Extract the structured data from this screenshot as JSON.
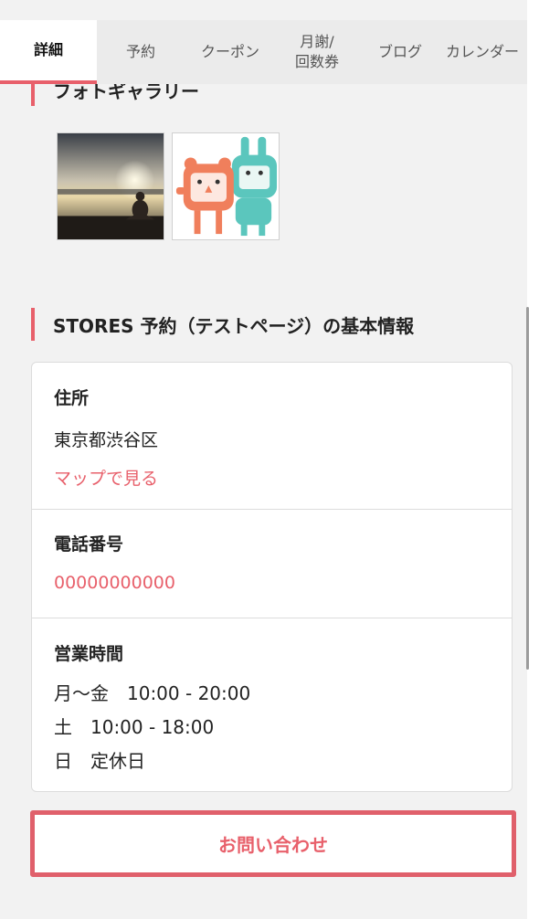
{
  "tabs": [
    {
      "label": "詳細",
      "active": true
    },
    {
      "label": "予約",
      "active": false
    },
    {
      "label": "クーポン",
      "active": false
    },
    {
      "label_line1": "月謝/",
      "label_line2": "回数券",
      "active": false
    },
    {
      "label": "ブログ",
      "active": false
    },
    {
      "label": "カレンダー",
      "active": false
    }
  ],
  "gallery": {
    "title": "フォトギャラリー",
    "photos": [
      {
        "alt": "yoga-sunset-photo"
      },
      {
        "alt": "mascot-characters-image"
      }
    ]
  },
  "info": {
    "title": "STORES 予約（テストページ）の基本情報",
    "address": {
      "label": "住所",
      "value": "東京都渋谷区",
      "map_link": "マップで見る"
    },
    "phone": {
      "label": "電話番号",
      "value": "00000000000"
    },
    "hours": {
      "label": "営業時間",
      "lines": [
        "月〜金　10:00 - 20:00",
        "土　10:00 - 18:00",
        "日　定休日"
      ]
    }
  },
  "contact_button": "お問い合わせ",
  "colors": {
    "accent": "#e8606b",
    "tab_bg": "#ebebeb",
    "page_bg": "#f2f2f2"
  }
}
